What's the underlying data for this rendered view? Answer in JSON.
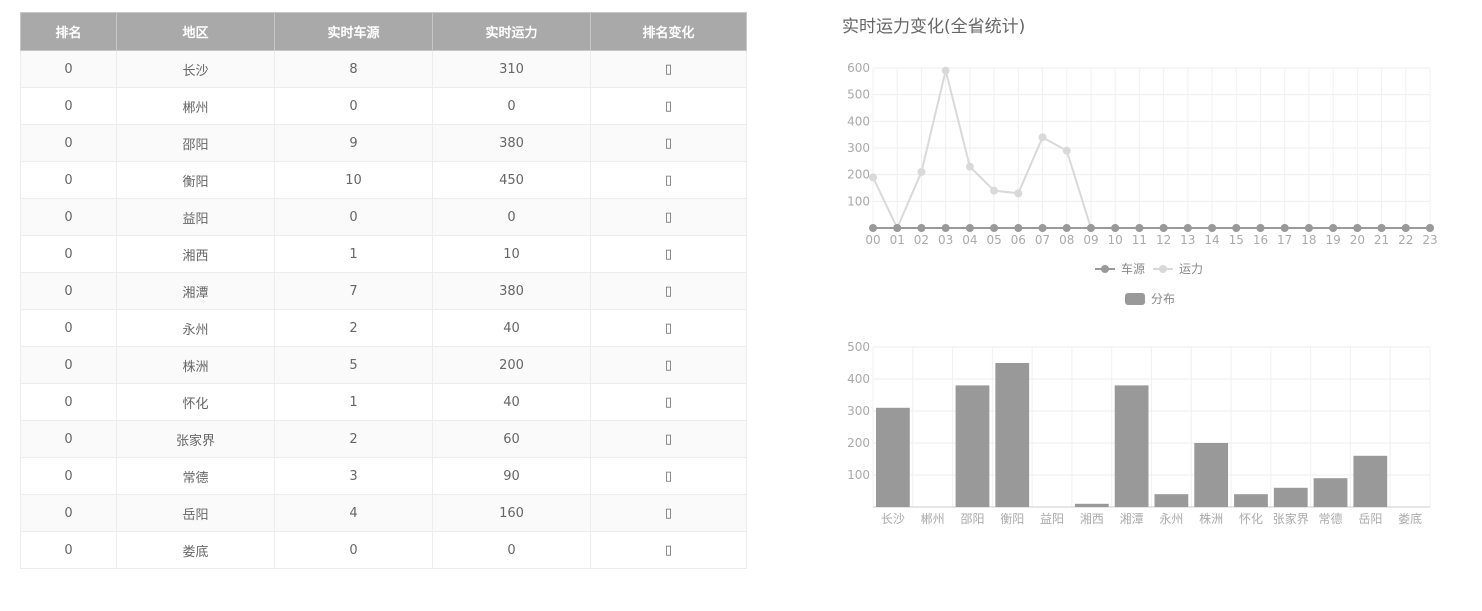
{
  "table": {
    "headers": [
      "排名",
      "地区",
      "实时车源",
      "实时运力",
      "排名变化"
    ],
    "rows": [
      [
        "0",
        "长沙",
        "8",
        "310",
        "▯"
      ],
      [
        "0",
        "郴州",
        "0",
        "0",
        "▯"
      ],
      [
        "0",
        "邵阳",
        "9",
        "380",
        "▯"
      ],
      [
        "0",
        "衡阳",
        "10",
        "450",
        "▯"
      ],
      [
        "0",
        "益阳",
        "0",
        "0",
        "▯"
      ],
      [
        "0",
        "湘西",
        "1",
        "10",
        "▯"
      ],
      [
        "0",
        "湘潭",
        "7",
        "380",
        "▯"
      ],
      [
        "0",
        "永州",
        "2",
        "40",
        "▯"
      ],
      [
        "0",
        "株洲",
        "5",
        "200",
        "▯"
      ],
      [
        "0",
        "怀化",
        "1",
        "40",
        "▯"
      ],
      [
        "0",
        "张家界",
        "2",
        "60",
        "▯"
      ],
      [
        "0",
        "常德",
        "3",
        "90",
        "▯"
      ],
      [
        "0",
        "岳阳",
        "4",
        "160",
        "▯"
      ],
      [
        "0",
        "娄底",
        "0",
        "0",
        "▯"
      ]
    ]
  },
  "colors": {
    "header_bg": "#a9a9a9",
    "series_dark": "#999999",
    "series_light": "#d9d9d9",
    "bar": "#999999"
  },
  "chart_data": [
    {
      "type": "line",
      "title": "实时运力变化(全省统计)",
      "x": [
        "00",
        "01",
        "02",
        "03",
        "04",
        "05",
        "06",
        "07",
        "08",
        "09",
        "10",
        "11",
        "12",
        "13",
        "14",
        "15",
        "16",
        "17",
        "18",
        "19",
        "20",
        "21",
        "22",
        "23"
      ],
      "yticks": [
        100,
        200,
        300,
        400,
        500,
        600
      ],
      "ylim": [
        0,
        600
      ],
      "grid": true,
      "legend_position": "bottom",
      "series": [
        {
          "name": "车源",
          "color": "#999999",
          "values": [
            0,
            0,
            0,
            0,
            0,
            0,
            0,
            0,
            0,
            0,
            0,
            0,
            0,
            0,
            0,
            0,
            0,
            0,
            0,
            0,
            0,
            0,
            0,
            0
          ]
        },
        {
          "name": "运力",
          "color": "#d9d9d9",
          "values": [
            190,
            0,
            210,
            590,
            230,
            140,
            130,
            340,
            290,
            0,
            0,
            0,
            0,
            0,
            0,
            0,
            0,
            0,
            0,
            0,
            0,
            0,
            0,
            0
          ]
        }
      ]
    },
    {
      "type": "bar",
      "categories": [
        "长沙",
        "郴州",
        "邵阳",
        "衡阳",
        "益阳",
        "湘西",
        "湘潭",
        "永州",
        "株洲",
        "怀化",
        "张家界",
        "常德",
        "岳阳",
        "娄底"
      ],
      "yticks": [
        100,
        200,
        300,
        400,
        500
      ],
      "ylim": [
        0,
        500
      ],
      "grid": true,
      "legend_position": "top",
      "series": [
        {
          "name": "分布",
          "color": "#999999",
          "values": [
            310,
            0,
            380,
            450,
            0,
            10,
            380,
            40,
            200,
            40,
            60,
            90,
            160,
            0
          ]
        }
      ]
    }
  ]
}
